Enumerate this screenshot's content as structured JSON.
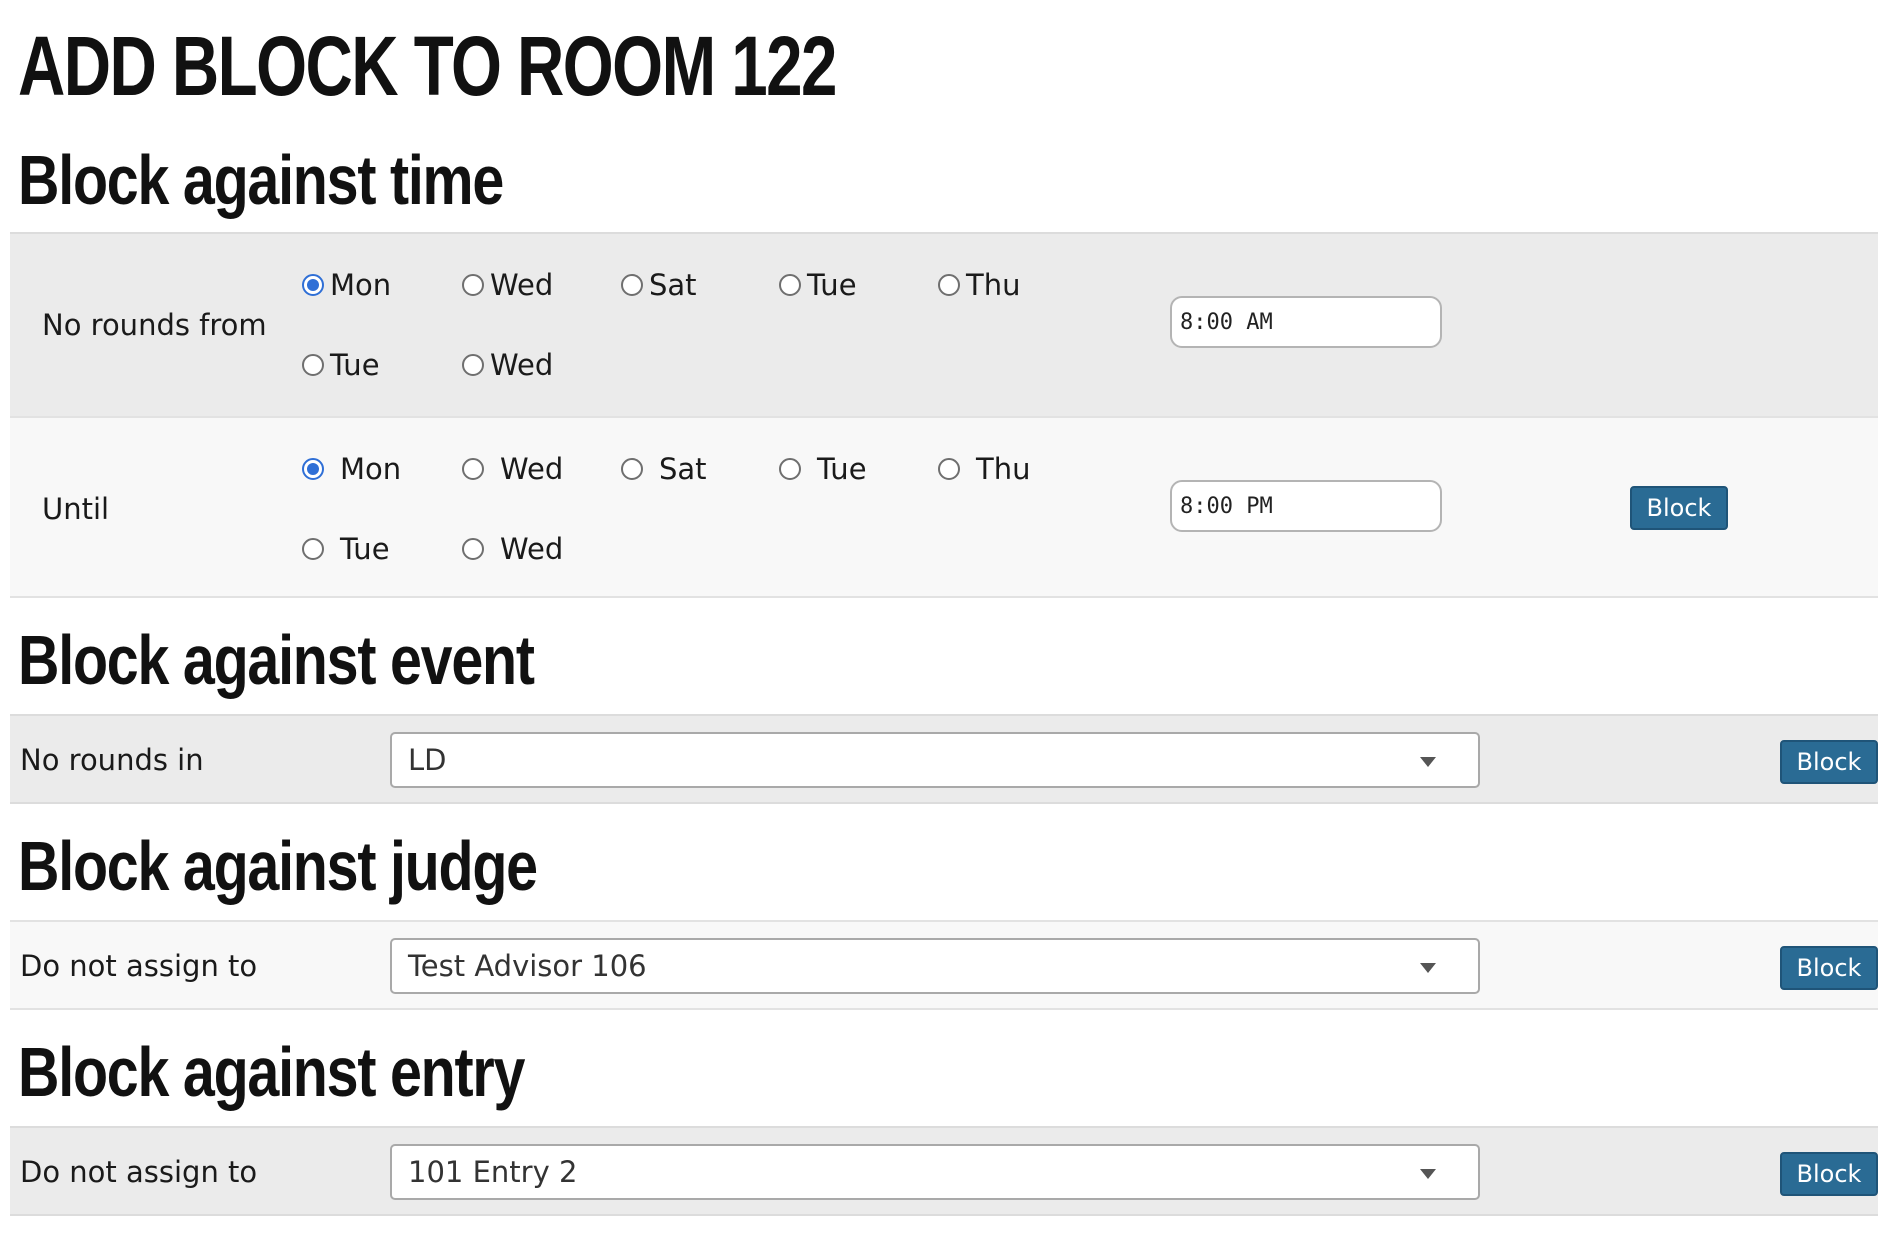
{
  "page_title": "ADD BLOCK TO ROOM 122",
  "time_section": {
    "heading": "Block against time",
    "from_row": {
      "label": "No rounds from",
      "days": [
        "Mon",
        "Wed",
        "Sat",
        "Tue",
        "Thu",
        "Tue",
        "Wed"
      ],
      "selected_day": "Mon",
      "time_value": "8:00 AM"
    },
    "until_row": {
      "label": "Until",
      "days": [
        "Mon",
        "Wed",
        "Sat",
        "Tue",
        "Thu",
        "Tue",
        "Wed"
      ],
      "selected_day": "Mon",
      "time_value": "8:00 PM",
      "button_label": "Block"
    }
  },
  "event_section": {
    "heading": "Block against event",
    "label": "No rounds in",
    "selected": "LD",
    "button_label": "Block"
  },
  "judge_section": {
    "heading": "Block against judge",
    "label": "Do not assign to",
    "selected": "Test Advisor 106",
    "button_label": "Block"
  },
  "entry_section": {
    "heading": "Block against entry",
    "label": "Do not assign to",
    "selected": "101 Entry 2",
    "button_label": "Block"
  },
  "colors": {
    "button_bg": "#2a6b94",
    "radio_selected": "#2f6fd6",
    "row_dark": "#ebebeb",
    "row_light": "#f8f8f8"
  }
}
